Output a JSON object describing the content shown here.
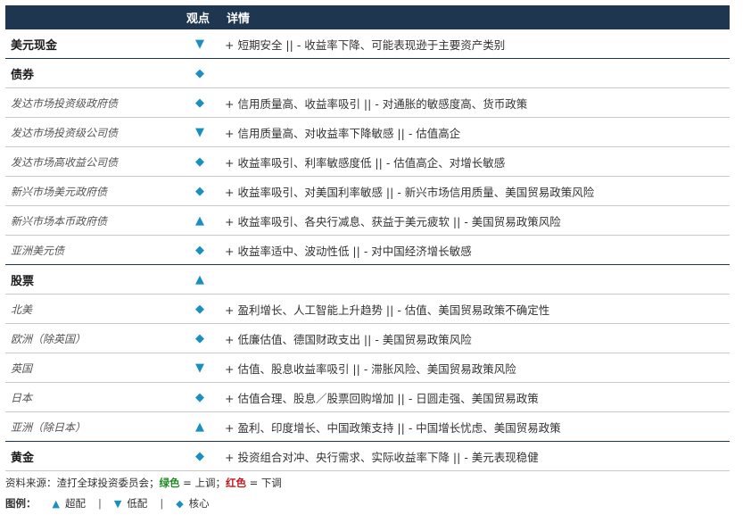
{
  "header": {
    "col_view": "观点",
    "col_detail": "详情"
  },
  "colors": {
    "header_bg": "#1e3650",
    "symbol": "#1a8fc2",
    "green": "#1f8a1f",
    "red": "#c0161b"
  },
  "rows": [
    {
      "type": "cat",
      "name": "美元现金",
      "view": "down",
      "detail": "+ 短期安全 || - 收益率下降、可能表现逊于主要资产类别"
    },
    {
      "type": "cat",
      "name": "债券",
      "view": "core",
      "detail": ""
    },
    {
      "type": "sub",
      "name": "发达市场投资级政府债",
      "view": "core",
      "detail": "+ 信用质量高、收益率吸引 || - 对通胀的敏感度高、货币政策"
    },
    {
      "type": "sub",
      "name": "发达市场投资级公司债",
      "view": "down",
      "detail": "+ 信用质量高、对收益率下降敏感 || - 估值高企"
    },
    {
      "type": "sub",
      "name": "发达市场高收益公司债",
      "view": "core",
      "detail": "+ 收益率吸引、利率敏感度低 || - 估值高企、对增长敏感"
    },
    {
      "type": "sub",
      "name": "新兴市场美元政府债",
      "view": "core",
      "detail": "+ 收益率吸引、对美国利率敏感 || - 新兴市场信用质量、美国贸易政策风险"
    },
    {
      "type": "sub",
      "name": "新兴市场本币政府债",
      "view": "up",
      "detail": "+ 收益率吸引、各央行减息、获益于美元疲软 || - 美国贸易政策风险"
    },
    {
      "type": "sub",
      "name": "亚洲美元债",
      "view": "core",
      "detail": "+ 收益率适中、波动性低 || - 对中国经济增长敏感"
    },
    {
      "type": "cat",
      "name": "股票",
      "view": "up",
      "detail": ""
    },
    {
      "type": "sub",
      "name": "北美",
      "view": "core",
      "detail": "+ 盈利增长、人工智能上升趋势 || - 估值、美国贸易政策不确定性"
    },
    {
      "type": "sub",
      "name": "欧洲（除英国）",
      "view": "core",
      "detail": "+ 低廉估值、德国财政支出 || - 美国贸易政策风险"
    },
    {
      "type": "sub",
      "name": "英国",
      "view": "down",
      "detail": "+ 估值、股息收益率吸引 || - 滞胀风险、美国贸易政策风险"
    },
    {
      "type": "sub",
      "name": "日本",
      "view": "core",
      "detail": "+ 估值合理、股息／股票回购增加 || - 日圆走强、美国贸易政策"
    },
    {
      "type": "sub",
      "name": "亚洲（除日本）",
      "view": "up",
      "detail": "+ 盈利、印度增长、中国政策支持 || - 中国增长忧虑、美国贸易政策"
    },
    {
      "type": "cat",
      "name": "黄金",
      "view": "core",
      "detail": "+ 投资组合对冲、央行需求、实际收益率下降 || - 美元表现稳健"
    }
  ],
  "symbols": {
    "up": "▲",
    "down": "▼",
    "core": "◆"
  },
  "footer": {
    "source_prefix": "资料来源：渣打全球投资委员会；",
    "green_word": "绿色",
    "green_suffix": " = 上调；",
    "red_word": "红色",
    "red_suffix": " = 下调"
  },
  "legend": {
    "label": "图例：",
    "up_label": "超配",
    "down_label": "低配",
    "core_label": "核心",
    "separator": "|"
  }
}
